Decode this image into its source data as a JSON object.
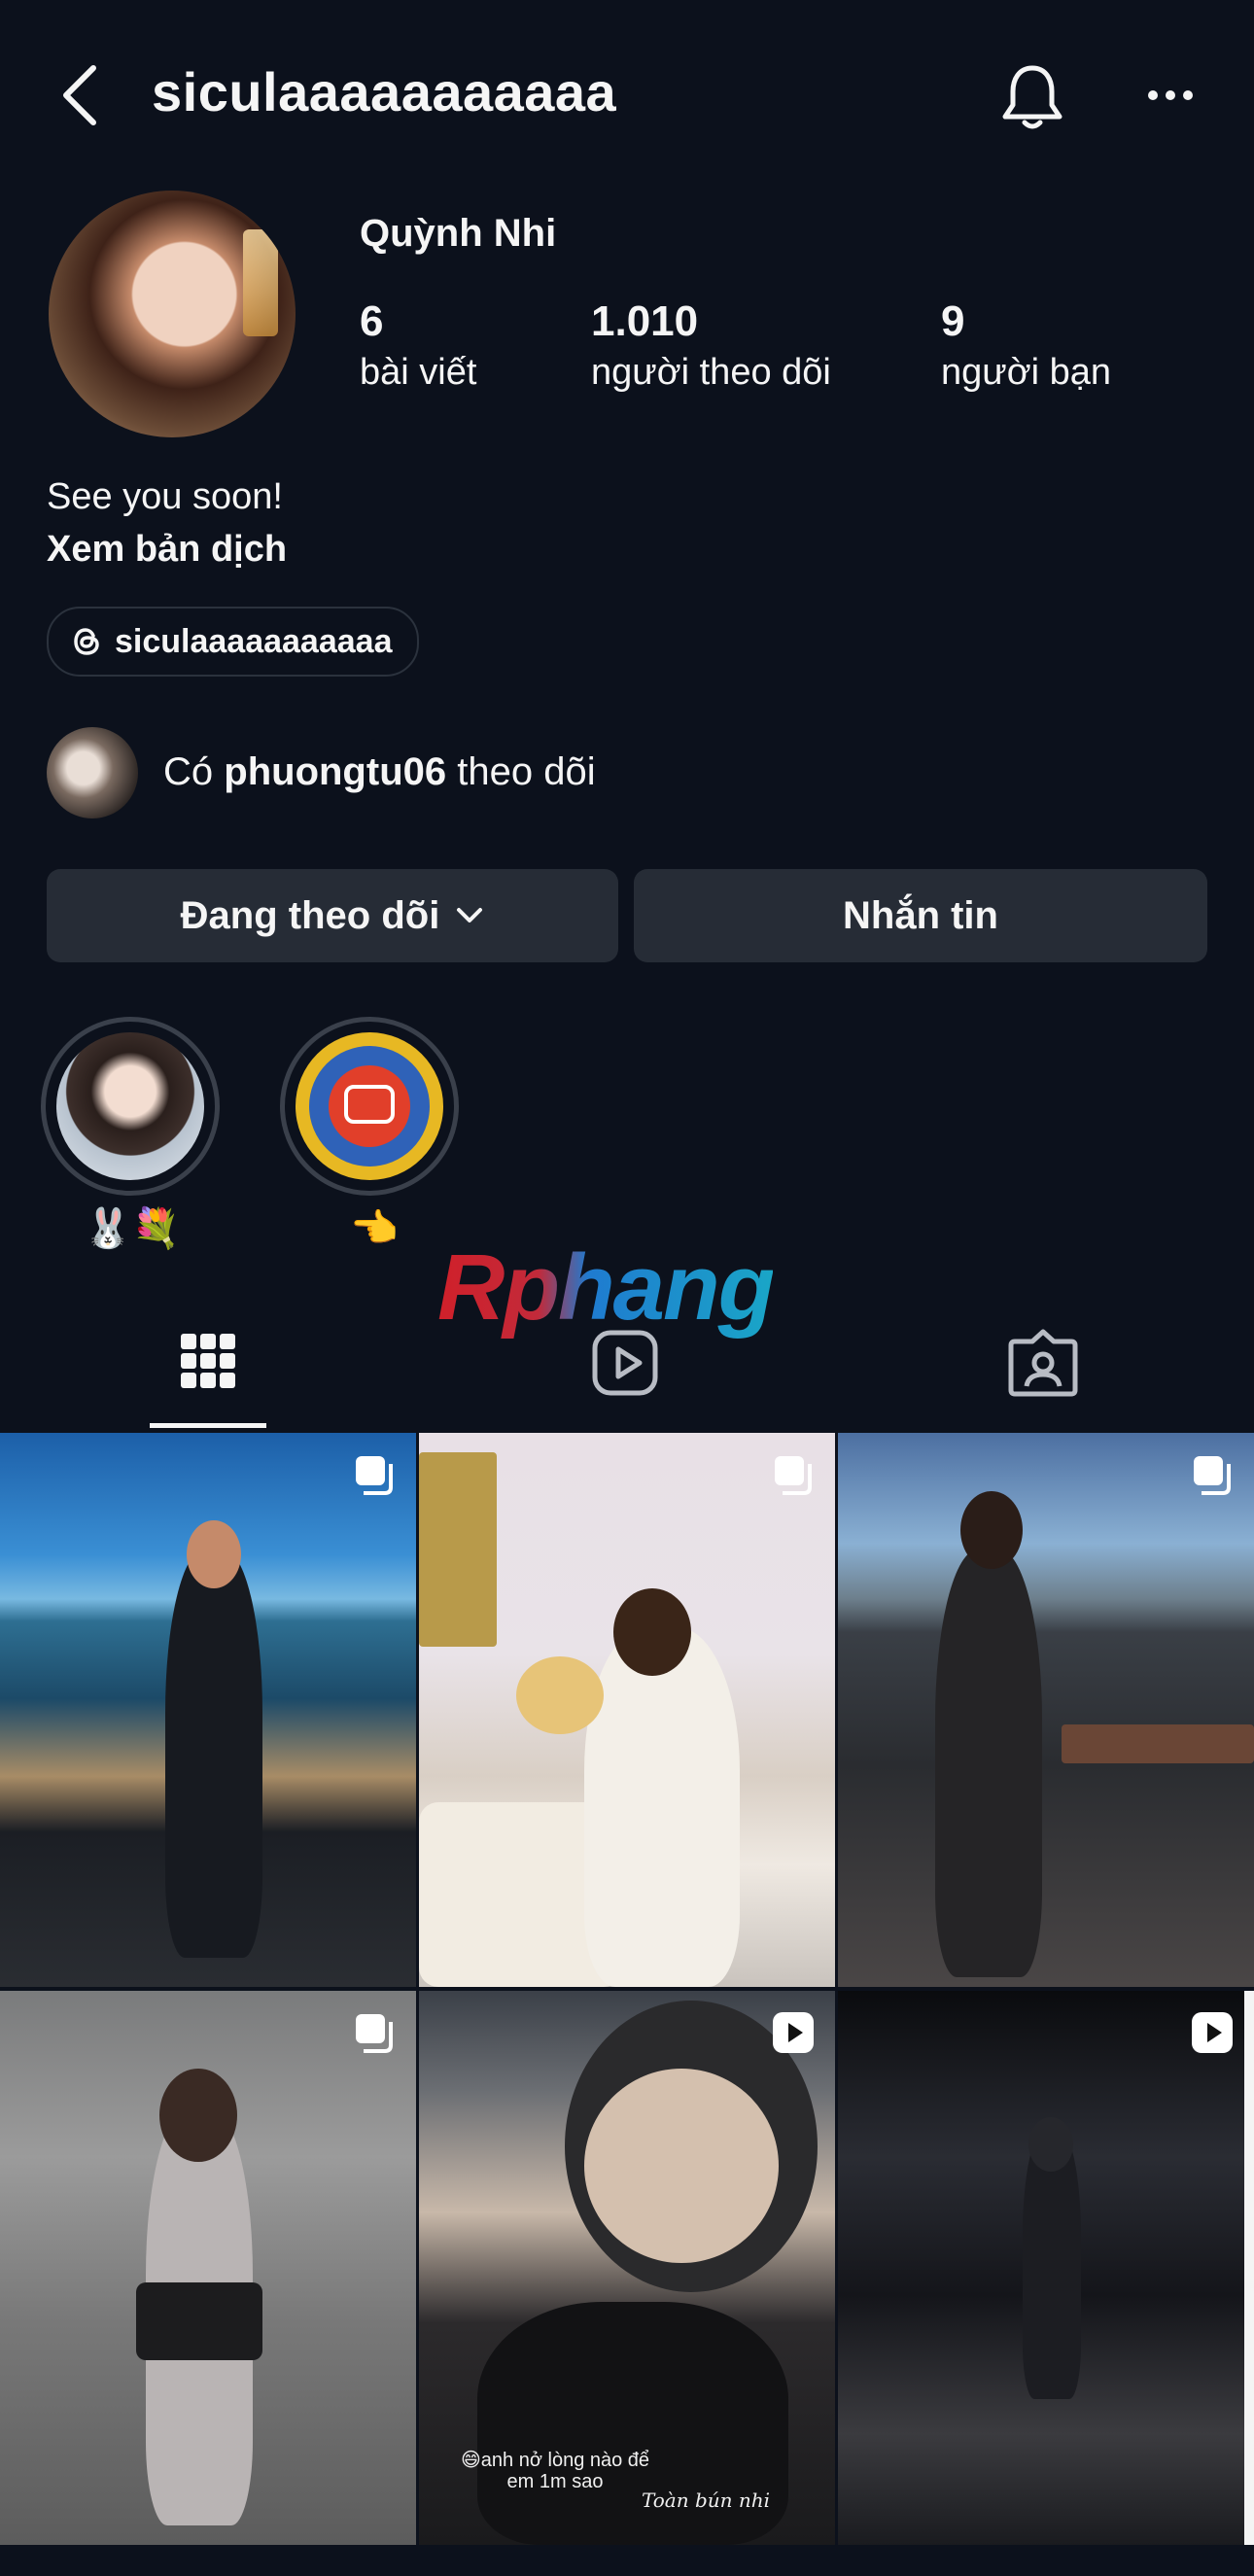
{
  "header": {
    "username": "siculaaaaaaaaaaa"
  },
  "profile": {
    "display_name": "Quỳnh Nhi",
    "stats": [
      {
        "value": "6",
        "label": "bài viết"
      },
      {
        "value": "1.010",
        "label": "người theo dõi"
      },
      {
        "value": "9",
        "label": "người bạn"
      }
    ],
    "bio": "See you soon!",
    "translate_label": "Xem bản dịch",
    "threads_handle": "siculaaaaaaaaaaa"
  },
  "mutual": {
    "prefix": "Có",
    "username": "phuongtu06",
    "suffix": "theo dõi"
  },
  "actions": {
    "following_label": "Đang theo dõi",
    "message_label": "Nhắn tin"
  },
  "highlights": [
    {
      "label": "🐰💐"
    },
    {
      "label": "👈"
    }
  ],
  "watermark": "Rphang",
  "grid": {
    "captions": {
      "post5_line1": "😄anh nở lòng nào để",
      "post5_line2": "em 1m sao",
      "post5_sign": "Toàn bún nhi"
    },
    "posts": [
      {
        "type": "carousel"
      },
      {
        "type": "carousel"
      },
      {
        "type": "carousel"
      },
      {
        "type": "carousel"
      },
      {
        "type": "reel"
      },
      {
        "type": "reel"
      }
    ]
  },
  "colors": {
    "background": "#0c111c",
    "button": "#262c36",
    "text": "#f5f5f5"
  }
}
